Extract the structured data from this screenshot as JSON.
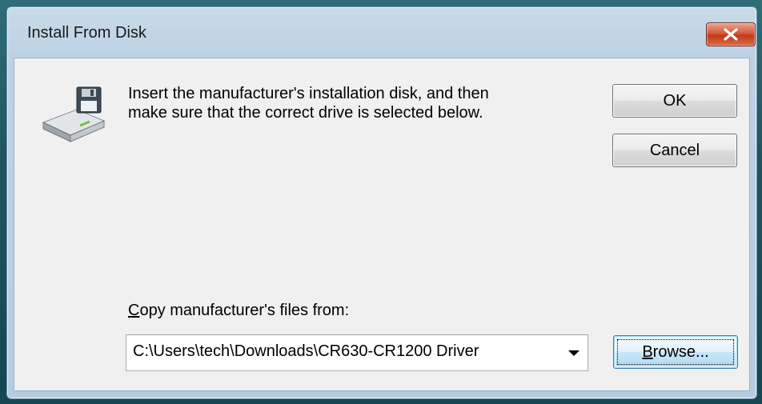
{
  "dialog": {
    "title": "Install From Disk",
    "message_line1": "Insert the manufacturer's installation disk, and then",
    "message_line2": "make sure that the correct drive is selected below.",
    "ok_label": "OK",
    "cancel_label": "Cancel",
    "copy_label_accel": "C",
    "copy_label_rest": "opy manufacturer's files from:",
    "path_value": "C:\\Users\\tech\\Downloads\\CR630-CR1200 Driver",
    "browse_accel": "B",
    "browse_rest": "rowse...",
    "icons": {
      "disk": "floppy-disk-drive-icon",
      "close": "close-icon",
      "dropdown": "chevron-down-icon"
    }
  },
  "colors": {
    "close_button": "#c2391b",
    "client_background": "#f0f0f0",
    "frame": "#bcd2e4",
    "focus_border": "#3c7fb1"
  }
}
